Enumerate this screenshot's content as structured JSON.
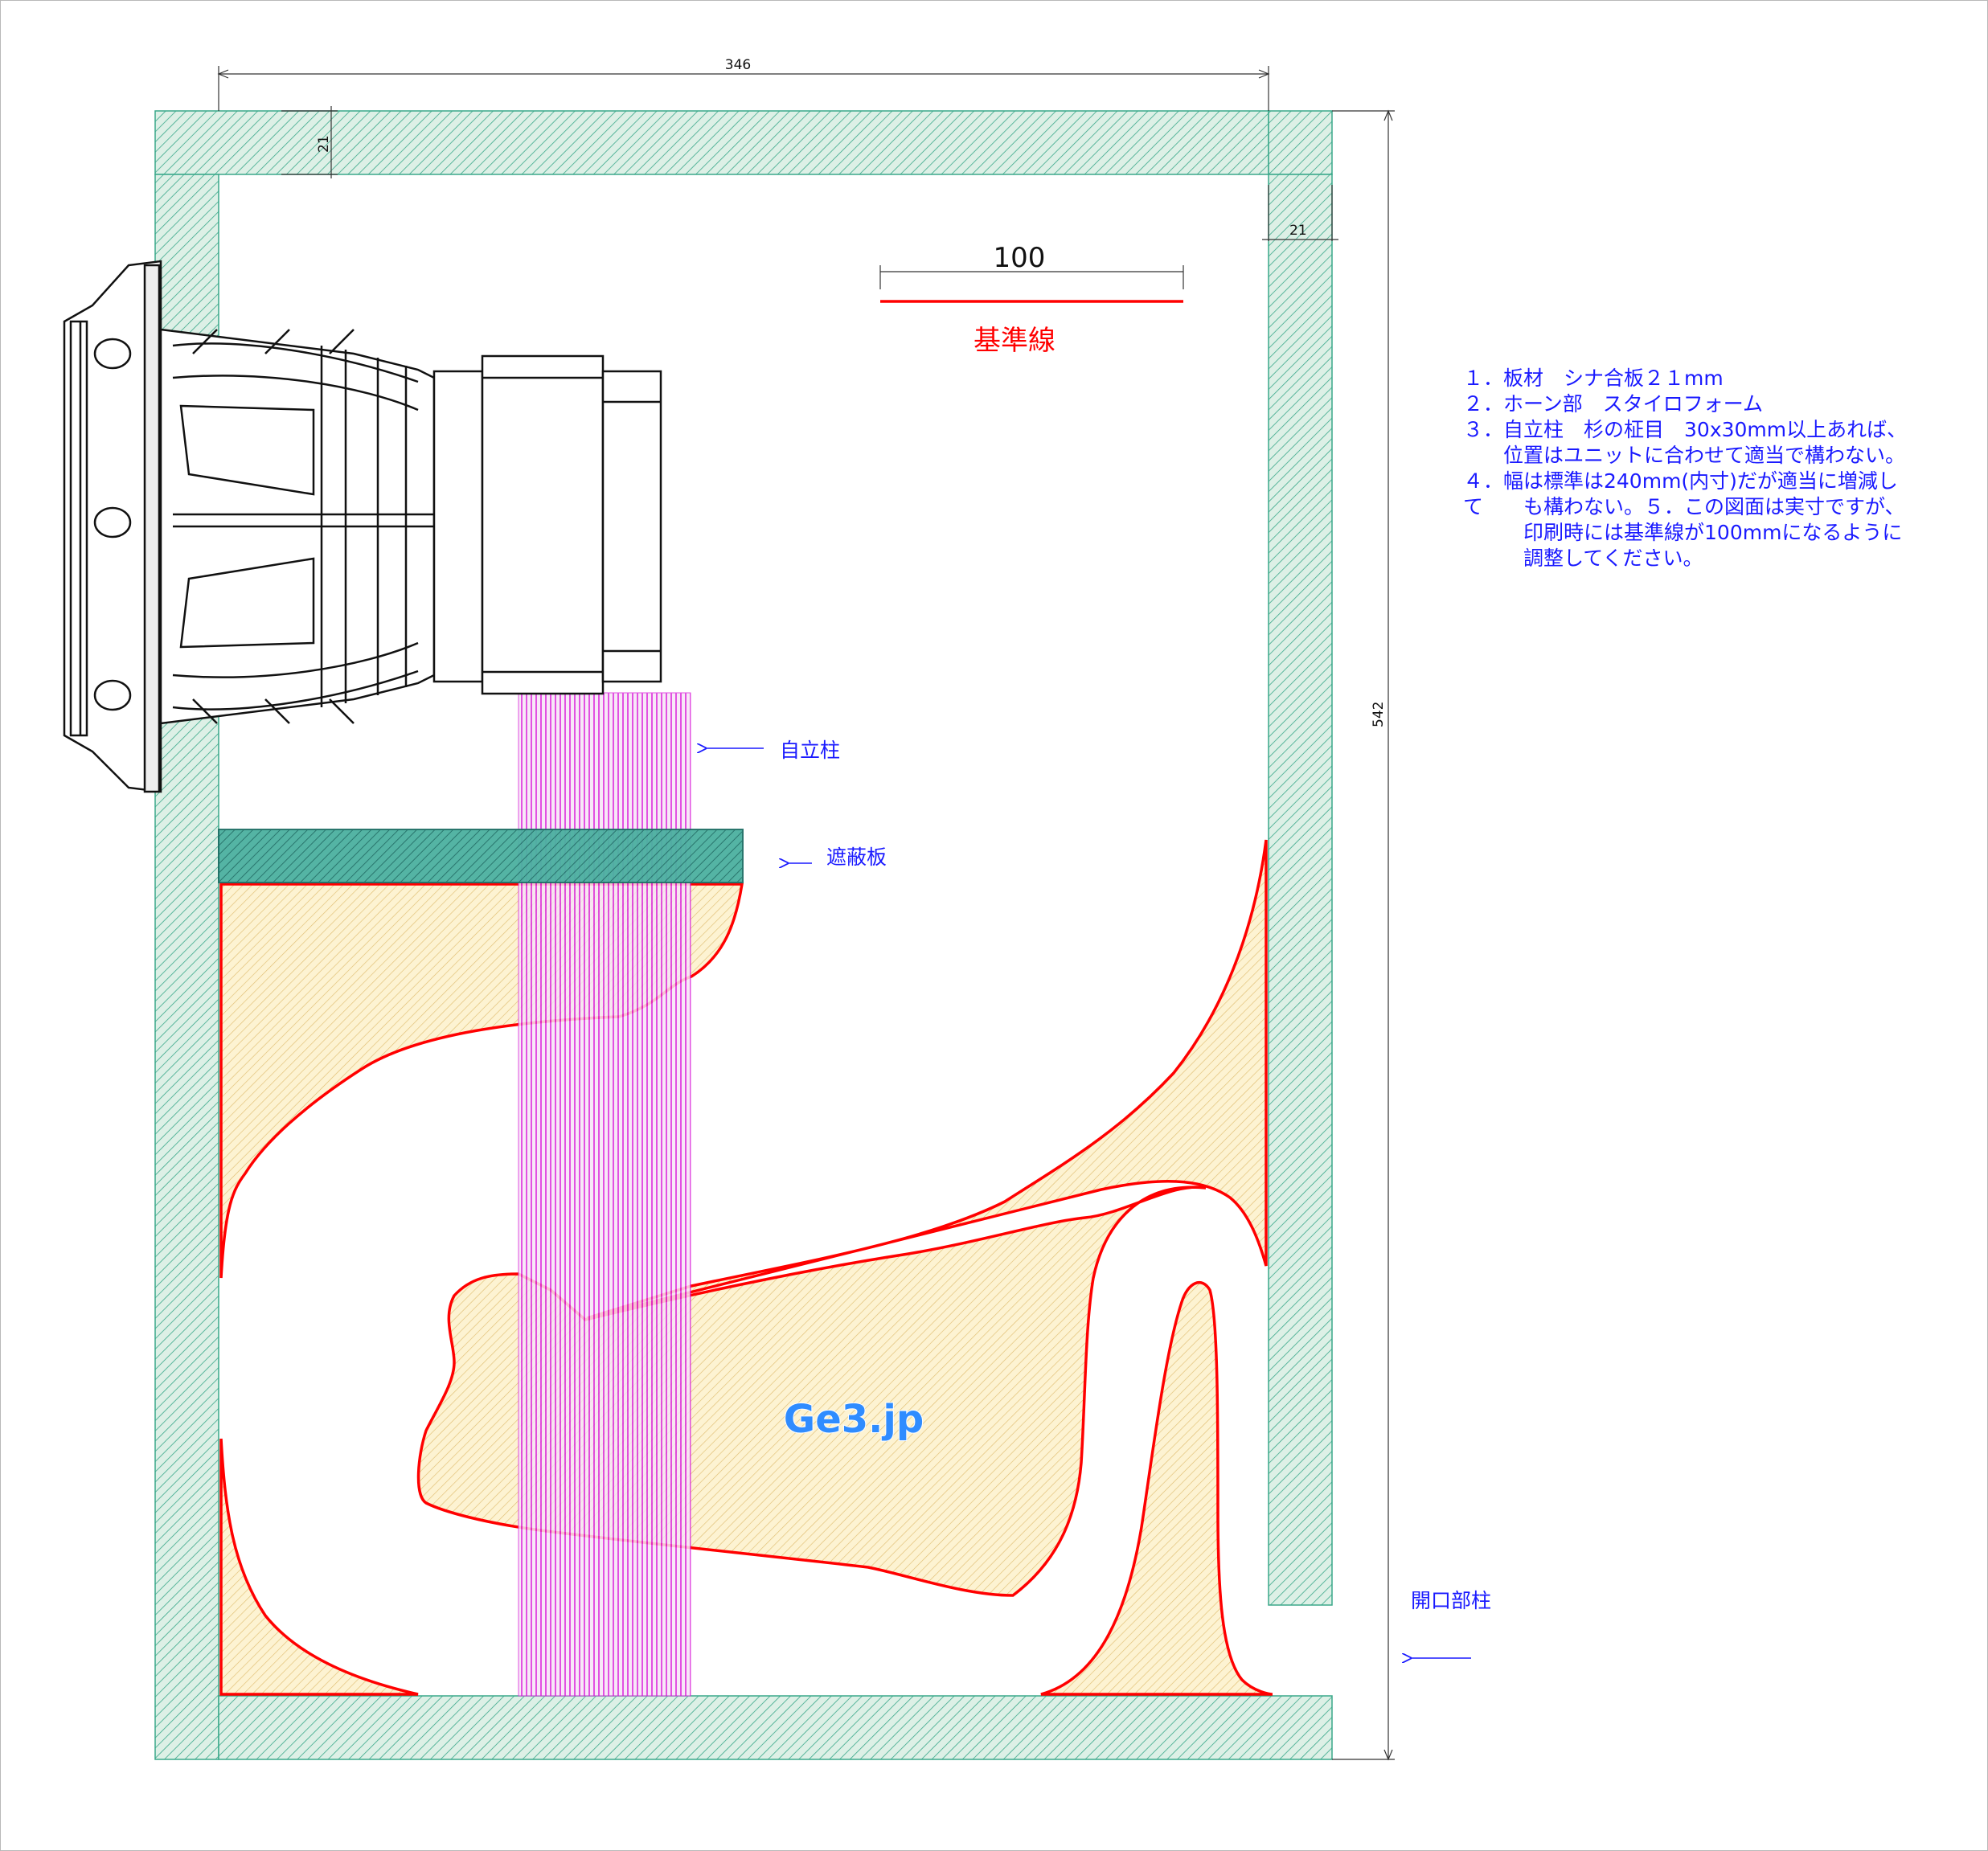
{
  "dimensions": {
    "width": "346",
    "height": "542",
    "top_board_thickness": "21",
    "side_board_thickness": "21"
  },
  "scale": {
    "value": "100",
    "label": "基準線"
  },
  "labels": {
    "pillar": "自立柱",
    "shield_board": "遮蔽板",
    "mouth_pillar": "開口部柱",
    "watermark": "Ge3.jp"
  },
  "notes": [
    "１．板材　シナ合板２１mm",
    "２．ホーン部　スタイロフォーム",
    "３．自立柱　杉の柾目　30x30mm以上あれば、",
    "　　位置はユニットに合わせて適当で構わない。",
    "４．幅は標準は240mm(内寸)だが適当に増減し",
    "て　　も構わない。５．この図面は実寸ですが、",
    "　　　印刷時には基準線が100mmになるように",
    "　　　調整してください。"
  ],
  "colors": {
    "board_fill": "#ddf0e6",
    "board_hatch": "#3aa88a",
    "horn_fill": "#fdf3d2",
    "horn_hatch": "#d9b35e",
    "horn_outline": "#ff0000",
    "pillar_hatch": "#dd33dd",
    "shield_fill": "#2a9d8f",
    "annotation": "#1a1aff",
    "scale_line": "#ff0000"
  }
}
